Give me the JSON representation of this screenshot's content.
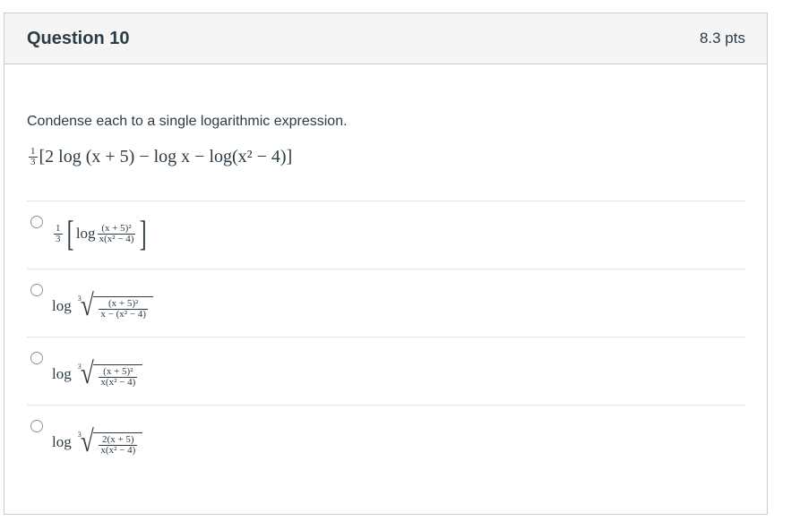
{
  "question": {
    "title": "Question 10",
    "points": "8.3 pts",
    "prompt": "Condense each to a single logarithmic expression.",
    "expression": {
      "coef_num": "1",
      "coef_den": "3",
      "body": "2 log (x + 5) − log x − log(x² − 4)"
    }
  },
  "answers": [
    {
      "coef_num": "1",
      "coef_den": "3",
      "log": "log",
      "num": "(x + 5)²",
      "den": "x(x² − 4)",
      "root_index": ""
    },
    {
      "log": "log",
      "root_index": "3",
      "num": "(x + 5)²",
      "den": "x − (x² − 4)"
    },
    {
      "log": "log",
      "root_index": "3",
      "num": "(x + 5)²",
      "den": "x(x² − 4)"
    },
    {
      "log": "log",
      "root_index": "3",
      "num": "2(x + 5)",
      "den": "x(x² − 4)"
    }
  ]
}
